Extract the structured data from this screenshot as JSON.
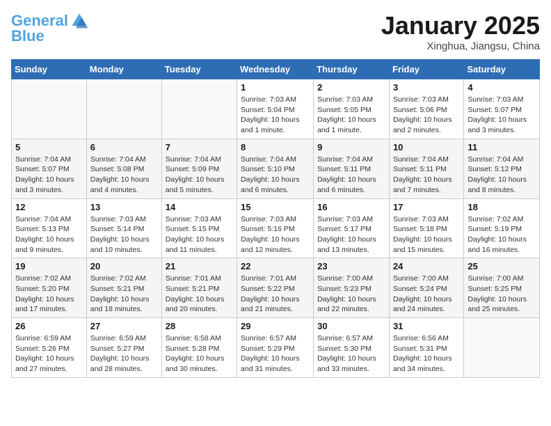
{
  "header": {
    "logo_line1": "General",
    "logo_line2": "Blue",
    "month_title": "January 2025",
    "location": "Xinghua, Jiangsu, China"
  },
  "weekdays": [
    "Sunday",
    "Monday",
    "Tuesday",
    "Wednesday",
    "Thursday",
    "Friday",
    "Saturday"
  ],
  "weeks": [
    [
      {
        "day": "",
        "info": ""
      },
      {
        "day": "",
        "info": ""
      },
      {
        "day": "",
        "info": ""
      },
      {
        "day": "1",
        "info": "Sunrise: 7:03 AM\nSunset: 5:04 PM\nDaylight: 10 hours\nand 1 minute."
      },
      {
        "day": "2",
        "info": "Sunrise: 7:03 AM\nSunset: 5:05 PM\nDaylight: 10 hours\nand 1 minute."
      },
      {
        "day": "3",
        "info": "Sunrise: 7:03 AM\nSunset: 5:06 PM\nDaylight: 10 hours\nand 2 minutes."
      },
      {
        "day": "4",
        "info": "Sunrise: 7:03 AM\nSunset: 5:07 PM\nDaylight: 10 hours\nand 3 minutes."
      }
    ],
    [
      {
        "day": "5",
        "info": "Sunrise: 7:04 AM\nSunset: 5:07 PM\nDaylight: 10 hours\nand 3 minutes."
      },
      {
        "day": "6",
        "info": "Sunrise: 7:04 AM\nSunset: 5:08 PM\nDaylight: 10 hours\nand 4 minutes."
      },
      {
        "day": "7",
        "info": "Sunrise: 7:04 AM\nSunset: 5:09 PM\nDaylight: 10 hours\nand 5 minutes."
      },
      {
        "day": "8",
        "info": "Sunrise: 7:04 AM\nSunset: 5:10 PM\nDaylight: 10 hours\nand 6 minutes."
      },
      {
        "day": "9",
        "info": "Sunrise: 7:04 AM\nSunset: 5:11 PM\nDaylight: 10 hours\nand 6 minutes."
      },
      {
        "day": "10",
        "info": "Sunrise: 7:04 AM\nSunset: 5:11 PM\nDaylight: 10 hours\nand 7 minutes."
      },
      {
        "day": "11",
        "info": "Sunrise: 7:04 AM\nSunset: 5:12 PM\nDaylight: 10 hours\nand 8 minutes."
      }
    ],
    [
      {
        "day": "12",
        "info": "Sunrise: 7:04 AM\nSunset: 5:13 PM\nDaylight: 10 hours\nand 9 minutes."
      },
      {
        "day": "13",
        "info": "Sunrise: 7:03 AM\nSunset: 5:14 PM\nDaylight: 10 hours\nand 10 minutes."
      },
      {
        "day": "14",
        "info": "Sunrise: 7:03 AM\nSunset: 5:15 PM\nDaylight: 10 hours\nand 11 minutes."
      },
      {
        "day": "15",
        "info": "Sunrise: 7:03 AM\nSunset: 5:16 PM\nDaylight: 10 hours\nand 12 minutes."
      },
      {
        "day": "16",
        "info": "Sunrise: 7:03 AM\nSunset: 5:17 PM\nDaylight: 10 hours\nand 13 minutes."
      },
      {
        "day": "17",
        "info": "Sunrise: 7:03 AM\nSunset: 5:18 PM\nDaylight: 10 hours\nand 15 minutes."
      },
      {
        "day": "18",
        "info": "Sunrise: 7:02 AM\nSunset: 5:19 PM\nDaylight: 10 hours\nand 16 minutes."
      }
    ],
    [
      {
        "day": "19",
        "info": "Sunrise: 7:02 AM\nSunset: 5:20 PM\nDaylight: 10 hours\nand 17 minutes."
      },
      {
        "day": "20",
        "info": "Sunrise: 7:02 AM\nSunset: 5:21 PM\nDaylight: 10 hours\nand 18 minutes."
      },
      {
        "day": "21",
        "info": "Sunrise: 7:01 AM\nSunset: 5:21 PM\nDaylight: 10 hours\nand 20 minutes."
      },
      {
        "day": "22",
        "info": "Sunrise: 7:01 AM\nSunset: 5:22 PM\nDaylight: 10 hours\nand 21 minutes."
      },
      {
        "day": "23",
        "info": "Sunrise: 7:00 AM\nSunset: 5:23 PM\nDaylight: 10 hours\nand 22 minutes."
      },
      {
        "day": "24",
        "info": "Sunrise: 7:00 AM\nSunset: 5:24 PM\nDaylight: 10 hours\nand 24 minutes."
      },
      {
        "day": "25",
        "info": "Sunrise: 7:00 AM\nSunset: 5:25 PM\nDaylight: 10 hours\nand 25 minutes."
      }
    ],
    [
      {
        "day": "26",
        "info": "Sunrise: 6:59 AM\nSunset: 5:26 PM\nDaylight: 10 hours\nand 27 minutes."
      },
      {
        "day": "27",
        "info": "Sunrise: 6:59 AM\nSunset: 5:27 PM\nDaylight: 10 hours\nand 28 minutes."
      },
      {
        "day": "28",
        "info": "Sunrise: 6:58 AM\nSunset: 5:28 PM\nDaylight: 10 hours\nand 30 minutes."
      },
      {
        "day": "29",
        "info": "Sunrise: 6:57 AM\nSunset: 5:29 PM\nDaylight: 10 hours\nand 31 minutes."
      },
      {
        "day": "30",
        "info": "Sunrise: 6:57 AM\nSunset: 5:30 PM\nDaylight: 10 hours\nand 33 minutes."
      },
      {
        "day": "31",
        "info": "Sunrise: 6:56 AM\nSunset: 5:31 PM\nDaylight: 10 hours\nand 34 minutes."
      },
      {
        "day": "",
        "info": ""
      }
    ]
  ]
}
